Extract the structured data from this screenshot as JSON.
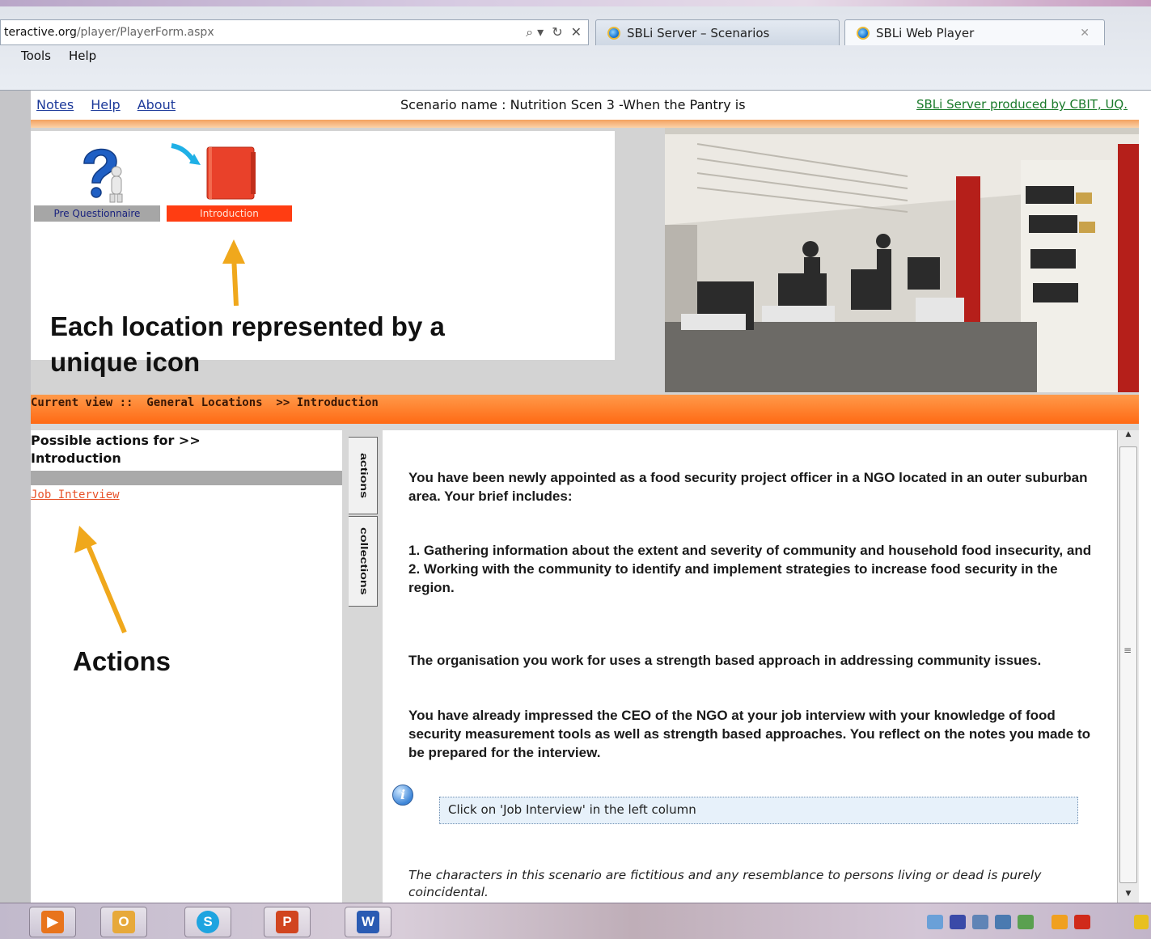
{
  "browser": {
    "address": {
      "domain": "teractive.org",
      "path": "/player/PlayerForm.aspx"
    },
    "nav_controls": [
      "⌕ ▾",
      "↻",
      "✕"
    ],
    "tabs": [
      {
        "title": "SBLi Server – Scenarios"
      },
      {
        "title": "SBLi Web Player",
        "close": "✕"
      }
    ],
    "menu": [
      "Tools",
      "Help"
    ]
  },
  "player": {
    "links": {
      "notes": "Notes",
      "help": "Help",
      "about": "About"
    },
    "scenario_name": "Scenario name : Nutrition Scen 3 -When the Pantry is",
    "producer": "SBLi Server produced by CBIT, UQ.",
    "locations": [
      {
        "label": "Pre Questionnaire",
        "icon": "question-mark-person-icon"
      },
      {
        "label": "Introduction",
        "icon": "red-folder-icon"
      }
    ],
    "annotation_location": "Each location represented by a\nunique icon",
    "current_view": "Current view ::  General Locations  >> Introduction",
    "actions_header": "Possible actions for >>\nIntroduction",
    "action_items": [
      "Job Interview"
    ],
    "annotation_actions": "Actions",
    "side_tabs": [
      "actions",
      "collections"
    ],
    "content": {
      "paragraph1": "You have been newly appointed as a food security project officer in a NGO located in an outer suburban area. Your brief includes:",
      "paragraph2": "1. Gathering information about the extent and severity of community and household food insecurity, and\n2.  Working with the community to identify and implement strategies to increase food security in the region.",
      "paragraph3": "The organisation you work for uses a strength based approach in addressing community issues.",
      "paragraph4": "You have already impressed the CEO of the NGO at your job interview with your knowledge of food security measurement tools as well as strength based approaches. You reflect on the notes you made to be prepared for the interview.",
      "hint": "Click on 'Job Interview' in the left column",
      "disclaimer": "The characters in this scenario are fictitious and any resemblance to persons living or dead is purely coincidental."
    },
    "scroll_grip": "≡"
  },
  "taskbar": {
    "apps": [
      {
        "name": "media-player",
        "glyph": "▶",
        "color": "#e8741c"
      },
      {
        "name": "outlook",
        "glyph": "O",
        "color": "#e7a93a"
      },
      {
        "name": "skype",
        "glyph": "S",
        "color": "#1ea4e0"
      },
      {
        "name": "powerpoint",
        "glyph": "P",
        "color": "#d1451f"
      },
      {
        "name": "word",
        "glyph": "W",
        "color": "#2a5bb3"
      }
    ]
  },
  "colors": {
    "accent_orange": "#ff6a14",
    "link_blue": "#1d3a9a",
    "producer_green": "#1a7a2a",
    "annotation_arrow": "#f0a81c",
    "action_link": "#e8532a"
  }
}
